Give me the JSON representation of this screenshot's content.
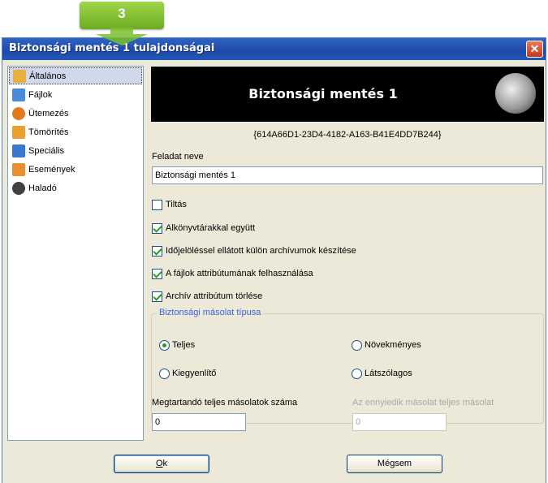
{
  "step": {
    "number": "3"
  },
  "window": {
    "title": "Biztonsági mentés 1 tulajdonságai",
    "close_glyph": "✕"
  },
  "sidebar": {
    "items": [
      {
        "label": "Általános",
        "icon": "general-icon",
        "color": "#e8b040",
        "active": true
      },
      {
        "label": "Fájlok",
        "icon": "files-icon",
        "color": "#4a8ad8"
      },
      {
        "label": "Ütemezés",
        "icon": "schedule-icon",
        "color": "#e07a20"
      },
      {
        "label": "Tömörítés",
        "icon": "compression-icon",
        "color": "#e8a030"
      },
      {
        "label": "Speciális",
        "icon": "special-icon",
        "color": "#3a78d0"
      },
      {
        "label": "Események",
        "icon": "events-icon",
        "color": "#e89030"
      },
      {
        "label": "Haladó",
        "icon": "advanced-icon",
        "color": "#404040"
      }
    ]
  },
  "banner": {
    "title": "Biztonsági mentés 1",
    "image": "moon-image"
  },
  "guid": "{614A66D1-23D4-4182-A163-B41E4DD7B244}",
  "task_name": {
    "label": "Feladat neve",
    "value": "Biztonsági mentés 1"
  },
  "options": {
    "disable": {
      "label": "Tiltás",
      "checked": false
    },
    "subdirs": {
      "label": "Alkönyvtárakkal együtt",
      "checked": true
    },
    "timestamped": {
      "label": "Időjelöléssel ellátott külön archívumok készítése",
      "checked": true
    },
    "use_attr": {
      "label": "A fájlok attribútumának felhasználása",
      "checked": true
    },
    "clear_attr": {
      "label": "Archív attribútum törlése",
      "checked": true
    }
  },
  "backup_type": {
    "title": "Biztonsági másolat típusa",
    "full": {
      "label": "Teljes",
      "selected": true
    },
    "incremental": {
      "label": "Növekményes",
      "selected": false
    },
    "differential": {
      "label": "Kiegyenlítő",
      "selected": false
    },
    "dummy": {
      "label": "Látszólagos",
      "selected": false
    }
  },
  "keep_full": {
    "label": "Megtartandó teljes másolatok száma",
    "value": "0"
  },
  "nth_full": {
    "label": "Az ennyiedik másolat teljes másolat",
    "value": "0"
  },
  "buttons": {
    "ok_prefix": "",
    "ok_underlined": "O",
    "ok_rest": "k",
    "cancel_prefix": "Mé",
    "cancel_underlined": "g",
    "cancel_rest": "sem"
  },
  "colors": {
    "accent_green": "#21a121",
    "title_blue": "#2e63c4",
    "group_title": "#3a62d8"
  }
}
